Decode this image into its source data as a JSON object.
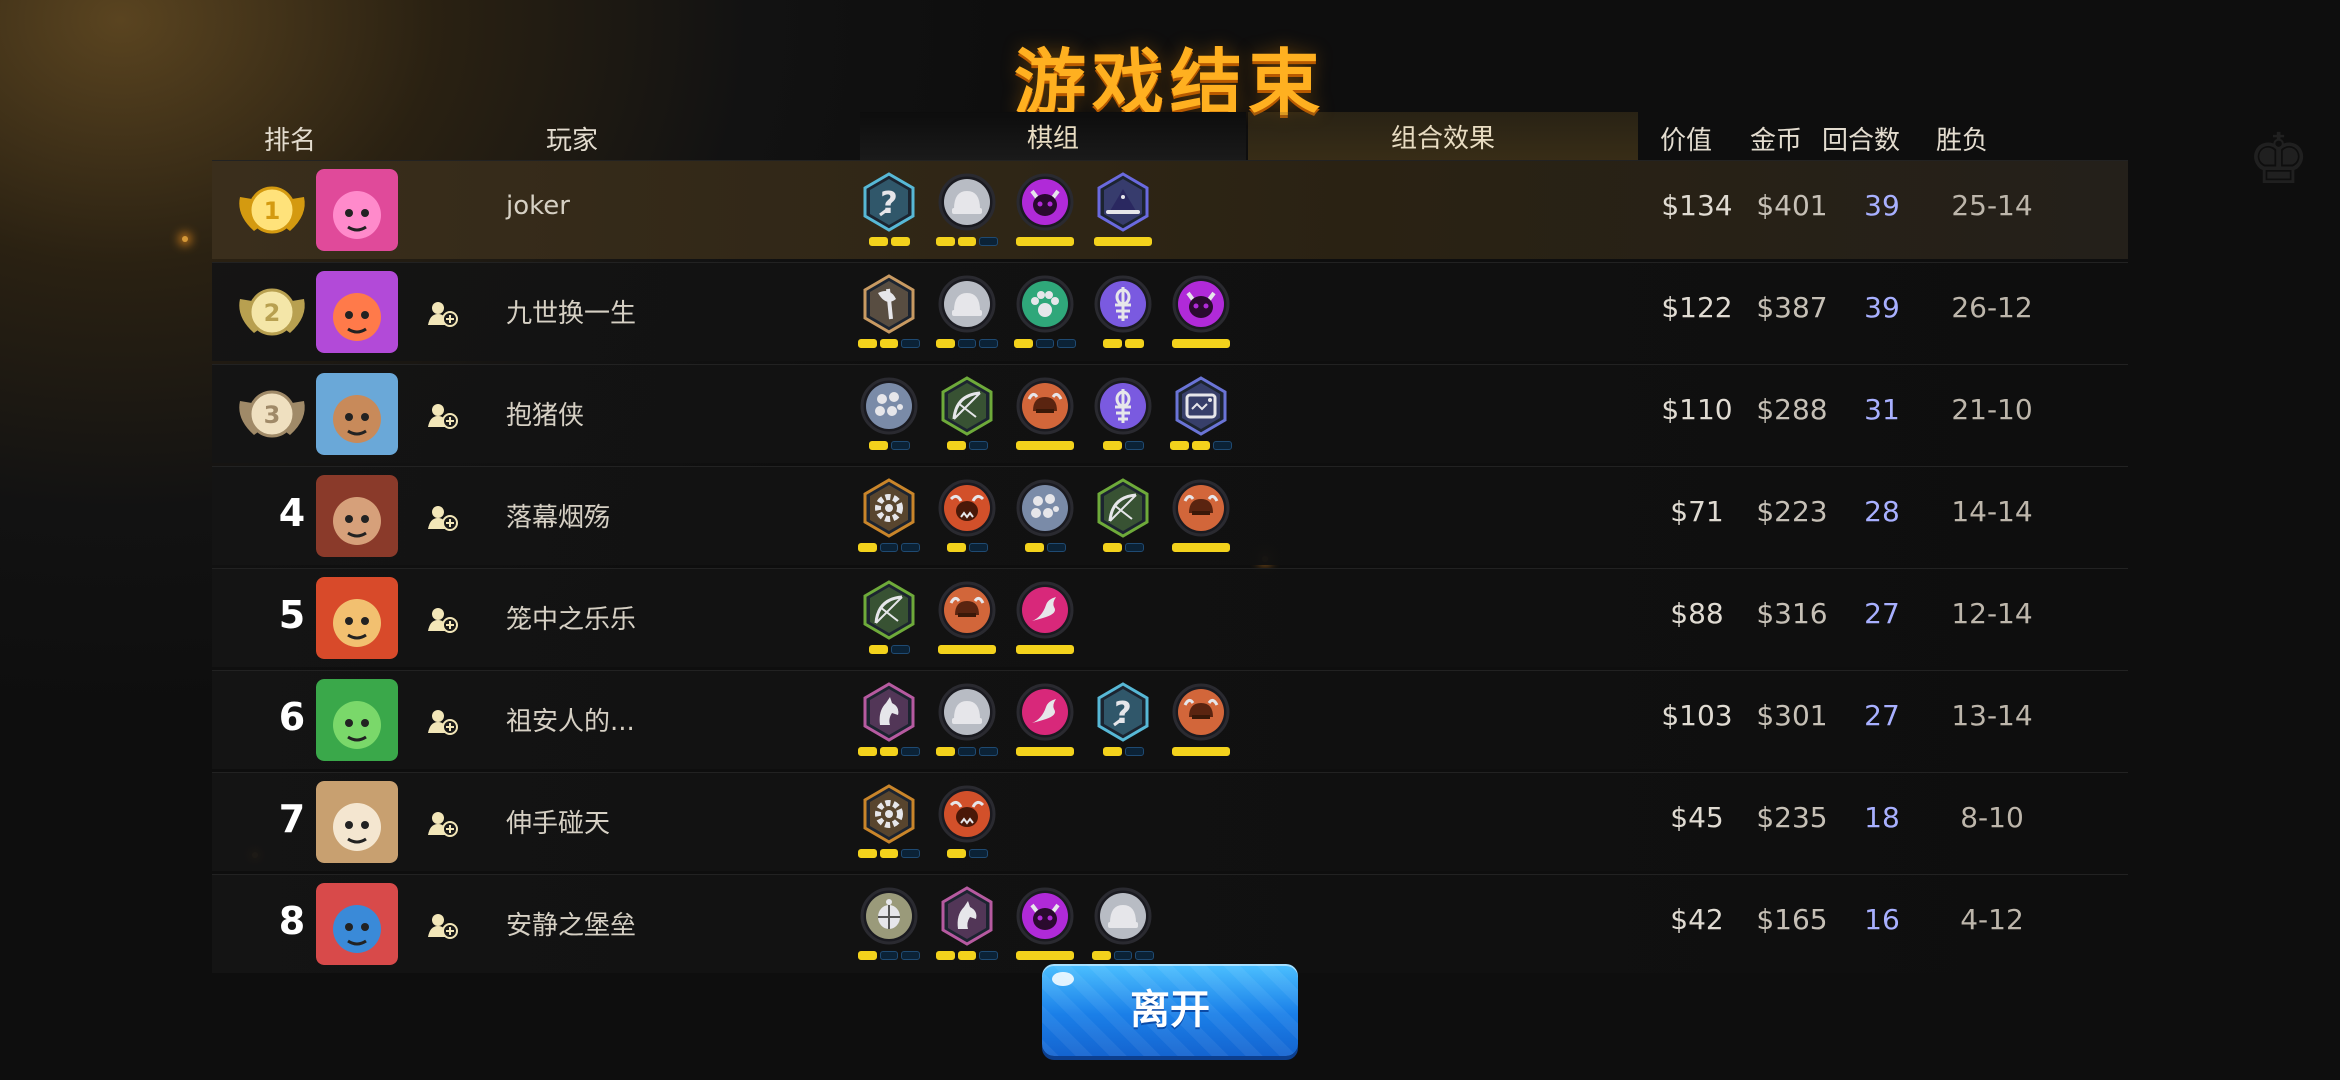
{
  "title": "游戏结束",
  "headers": {
    "rank": "排名",
    "player": "玩家",
    "chess": "棋组",
    "combo": "组合效果",
    "value": "价值",
    "gold": "金币",
    "rounds": "回合数",
    "winloss": "胜负"
  },
  "rows": [
    {
      "rank": "1",
      "name": "joker",
      "value": "$134",
      "gold": "$401",
      "rounds": "39",
      "wl": "25-14",
      "synergies": [
        {
          "icon": "question-icon",
          "frame": "hex",
          "color": "#57b8d6",
          "pips": [
            1,
            1
          ]
        },
        {
          "icon": "helmet-icon",
          "frame": "circle",
          "color": "#b8bcc4",
          "pips": [
            1,
            1,
            0
          ]
        },
        {
          "icon": "demon-icon",
          "frame": "circle",
          "color": "#b02ad8",
          "pips": [
            1
          ]
        },
        {
          "icon": "wizard-hat-icon",
          "frame": "hex",
          "color": "#6a6adf",
          "pips": [
            1
          ]
        }
      ]
    },
    {
      "rank": "2",
      "name": "九世换一生",
      "value": "$122",
      "gold": "$387",
      "rounds": "39",
      "wl": "26-12",
      "synergies": [
        {
          "icon": "axe-icon",
          "frame": "hex",
          "color": "#c89a62",
          "pips": [
            1,
            1,
            0
          ]
        },
        {
          "icon": "helmet-icon",
          "frame": "circle",
          "color": "#b8bcc4",
          "pips": [
            1,
            0,
            0
          ]
        },
        {
          "icon": "paw-icon",
          "frame": "circle",
          "color": "#2fa77a",
          "pips": [
            1,
            0,
            0
          ]
        },
        {
          "icon": "fish-icon",
          "frame": "circle",
          "color": "#7a5ae0",
          "pips": [
            1,
            1
          ]
        },
        {
          "icon": "demon-icon",
          "frame": "circle",
          "color": "#b02ad8",
          "pips": [
            1
          ]
        }
      ]
    },
    {
      "rank": "3",
      "name": "抱猪侠",
      "value": "$110",
      "gold": "$288",
      "rounds": "31",
      "wl": "21-10",
      "synergies": [
        {
          "icon": "rocks-icon",
          "frame": "circle",
          "color": "#7a8ba8",
          "pips": [
            1,
            0
          ]
        },
        {
          "icon": "bow-icon",
          "frame": "hex",
          "color": "#6eaa3a",
          "pips": [
            1,
            0
          ]
        },
        {
          "icon": "viking-icon",
          "frame": "circle",
          "color": "#d2663a",
          "pips": [
            1
          ]
        },
        {
          "icon": "fish-icon",
          "frame": "circle",
          "color": "#7a5ae0",
          "pips": [
            1,
            0
          ]
        },
        {
          "icon": "mech-icon",
          "frame": "hex",
          "color": "#6a74d6",
          "pips": [
            1,
            1,
            0
          ]
        }
      ]
    },
    {
      "rank": "4",
      "name": "落幕烟殇",
      "value": "$71",
      "gold": "$223",
      "rounds": "28",
      "wl": "14-14",
      "synergies": [
        {
          "icon": "gear-icon",
          "frame": "hex",
          "color": "#c9852a",
          "pips": [
            1,
            0,
            0
          ]
        },
        {
          "icon": "ogre-icon",
          "frame": "circle",
          "color": "#d2502a",
          "pips": [
            1,
            0
          ]
        },
        {
          "icon": "rocks-icon",
          "frame": "circle",
          "color": "#7a8ba8",
          "pips": [
            1,
            0
          ]
        },
        {
          "icon": "bow-icon",
          "frame": "hex",
          "color": "#6eaa3a",
          "pips": [
            1,
            0
          ]
        },
        {
          "icon": "viking-icon",
          "frame": "circle",
          "color": "#d2663a",
          "pips": [
            1
          ]
        }
      ]
    },
    {
      "rank": "5",
      "name": "笼中之乐乐",
      "value": "$88",
      "gold": "$316",
      "rounds": "27",
      "wl": "12-14",
      "synergies": [
        {
          "icon": "bow-icon",
          "frame": "hex",
          "color": "#6eaa3a",
          "pips": [
            1,
            0
          ]
        },
        {
          "icon": "viking-icon",
          "frame": "circle",
          "color": "#d2663a",
          "pips": [
            1
          ]
        },
        {
          "icon": "dragon-icon",
          "frame": "circle",
          "color": "#d8287a",
          "pips": [
            1
          ]
        }
      ]
    },
    {
      "rank": "6",
      "name": "祖安人的...",
      "value": "$103",
      "gold": "$301",
      "rounds": "27",
      "wl": "13-14",
      "synergies": [
        {
          "icon": "knight-icon",
          "frame": "hex",
          "color": "#b65aa0",
          "pips": [
            1,
            1,
            0
          ]
        },
        {
          "icon": "helmet-icon",
          "frame": "circle",
          "color": "#b8bcc4",
          "pips": [
            1,
            0,
            0
          ]
        },
        {
          "icon": "dragon-icon",
          "frame": "circle",
          "color": "#d8287a",
          "pips": [
            1
          ]
        },
        {
          "icon": "question-icon",
          "frame": "hex",
          "color": "#57b8d6",
          "pips": [
            1,
            0
          ]
        },
        {
          "icon": "viking-icon",
          "frame": "circle",
          "color": "#d2663a",
          "pips": [
            1
          ]
        }
      ]
    },
    {
      "rank": "7",
      "name": "伸手碰天",
      "value": "$45",
      "gold": "$235",
      "rounds": "18",
      "wl": "8-10",
      "synergies": [
        {
          "icon": "gear-icon",
          "frame": "hex",
          "color": "#c9852a",
          "pips": [
            1,
            1,
            0
          ]
        },
        {
          "icon": "ogre-icon",
          "frame": "circle",
          "color": "#d2502a",
          "pips": [
            1,
            0
          ]
        }
      ]
    },
    {
      "rank": "8",
      "name": "安静之堡垒",
      "value": "$42",
      "gold": "$165",
      "rounds": "16",
      "wl": "4-12",
      "synergies": [
        {
          "icon": "turtle-icon",
          "frame": "circle",
          "color": "#9a9a7a",
          "pips": [
            1,
            0,
            0
          ]
        },
        {
          "icon": "knight-icon",
          "frame": "hex",
          "color": "#b65aa0",
          "pips": [
            1,
            1,
            0
          ]
        },
        {
          "icon": "demon-icon",
          "frame": "circle",
          "color": "#b02ad8",
          "pips": [
            1
          ]
        },
        {
          "icon": "helmet-icon",
          "frame": "circle",
          "color": "#b8bcc4",
          "pips": [
            1,
            0,
            0
          ]
        }
      ]
    }
  ],
  "leave_button": "离开"
}
